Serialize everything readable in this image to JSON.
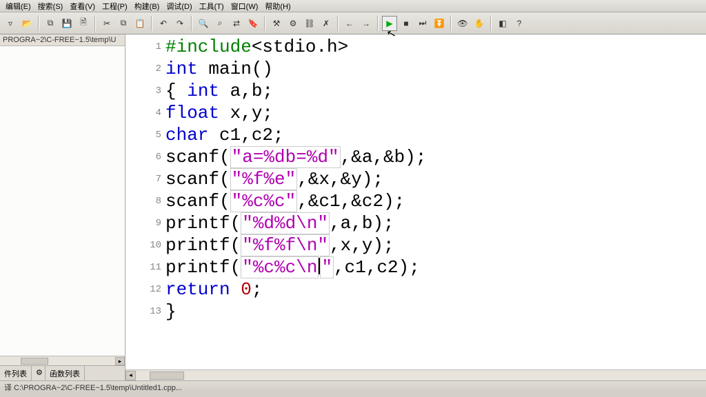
{
  "menus": [
    "编辑(E)",
    "搜索(S)",
    "查看(V)",
    "工程(P)",
    "构建(B)",
    "调试(D)",
    "工具(T)",
    "窗口(W)",
    "帮助(H)"
  ],
  "toolbar_icons": {
    "new": "▿",
    "open": "📂",
    "copy": "⧉",
    "save": "💾",
    "saveall": "🗎",
    "cut": "✂",
    "copy2": "⧉",
    "paste": "📋",
    "undo": "↶",
    "redo": "↷",
    "find": "🔍",
    "findnext": "⌕",
    "replace": "⇄",
    "bookmark": "🔖",
    "compile": "⚒",
    "build": "⚙",
    "buildall": "⛓",
    "rebuild": "✗",
    "back": "←",
    "fwd": "→",
    "run": "▶",
    "stop": "■",
    "step": "⏭",
    "stepinto": "⏬",
    "watch": "👁",
    "hand": "✋",
    "mgr": "◧",
    "help": "?"
  },
  "sidebar": {
    "path": "PROGRA~2\\C-FREE~1.5\\temp\\U",
    "tabs": {
      "files": "件列表",
      "funcs": "函数列表"
    }
  },
  "code": {
    "lines": [
      {
        "n": "1",
        "tokens": [
          [
            "pp",
            "#include"
          ],
          [
            "txt",
            "<stdio.h>"
          ]
        ]
      },
      {
        "n": "2",
        "tokens": [
          [
            "kw",
            "int"
          ],
          [
            "txt",
            " main()"
          ]
        ]
      },
      {
        "n": "3",
        "tokens": [
          [
            "txt",
            "{ "
          ],
          [
            "kw",
            "int"
          ],
          [
            "txt",
            " a,b;"
          ]
        ]
      },
      {
        "n": "4",
        "tokens": [
          [
            "kw",
            "float"
          ],
          [
            "txt",
            " x,y;"
          ]
        ]
      },
      {
        "n": "5",
        "tokens": [
          [
            "kw",
            "char"
          ],
          [
            "txt",
            " c1,c2;"
          ]
        ]
      },
      {
        "n": "6",
        "tokens": [
          [
            "txt",
            "scanf("
          ],
          [
            "str",
            "\"a=%db=%d\""
          ],
          [
            "txt",
            ",&a,&b);"
          ]
        ]
      },
      {
        "n": "7",
        "tokens": [
          [
            "txt",
            "scanf("
          ],
          [
            "str",
            "\"%f%e\""
          ],
          [
            "txt",
            ",&x,&y);"
          ]
        ]
      },
      {
        "n": "8",
        "tokens": [
          [
            "txt",
            "scanf("
          ],
          [
            "str",
            "\"%c%c\""
          ],
          [
            "txt",
            ",&c1,&c2);"
          ]
        ]
      },
      {
        "n": "9",
        "tokens": [
          [
            "txt",
            "printf("
          ],
          [
            "str",
            "\"%d%d\\n\""
          ],
          [
            "txt",
            ",a,b);"
          ]
        ]
      },
      {
        "n": "10",
        "tokens": [
          [
            "txt",
            "printf("
          ],
          [
            "str",
            "\"%f%f\\n\""
          ],
          [
            "txt",
            ",x,y);"
          ]
        ]
      },
      {
        "n": "11",
        "tokens": [
          [
            "txt",
            "printf("
          ],
          [
            "str",
            "\"%c%c\\n"
          ],
          [
            "cursor",
            ""
          ],
          [
            "str2",
            "\""
          ],
          [
            "txt",
            ",c1,c2);"
          ]
        ]
      },
      {
        "n": "12",
        "tokens": [
          [
            "kw",
            "return"
          ],
          [
            "txt",
            " "
          ],
          [
            "num",
            "0"
          ],
          [
            "txt",
            ";"
          ]
        ]
      },
      {
        "n": "13",
        "tokens": [
          [
            "txt",
            "}"
          ]
        ]
      }
    ]
  },
  "status": "译 C:\\PROGRA~2\\C-FREE~1.5\\temp\\Untitled1.cpp..."
}
